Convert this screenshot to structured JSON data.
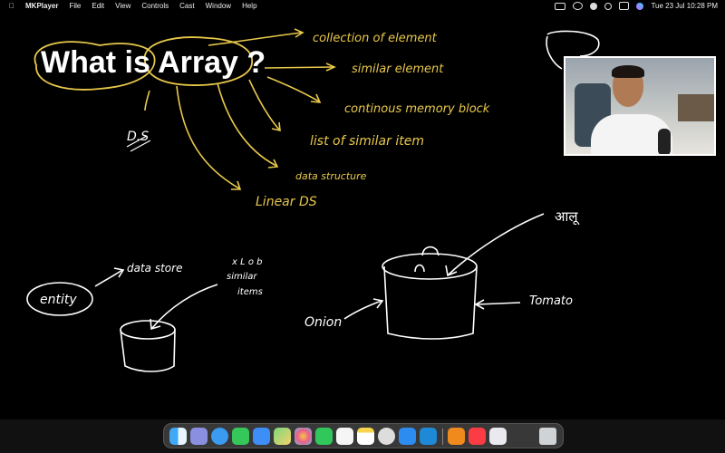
{
  "menubar": {
    "apple_glyph": "",
    "app_name": "MKPlayer",
    "menus": [
      "File",
      "Edit",
      "View",
      "Controls",
      "Cast",
      "Window",
      "Help"
    ],
    "clock": "Tue 23 Jul  10:28 PM"
  },
  "whiteboard": {
    "title": "What is Array ?",
    "ds_abbrev": "D.S",
    "definitions": [
      "collection of element",
      "similar element",
      "continous memory block",
      "list of similar item",
      "data structure",
      "Linear DS"
    ],
    "entity_label": "entity",
    "data_store_label": "data store",
    "items_note": [
      "x L o b",
      "similar",
      "items"
    ],
    "onion_label": "Onion",
    "tomato_label": "Tomato",
    "aloo_label": "आलू"
  },
  "dock": {
    "apps": [
      "finder",
      "launchpad",
      "safari",
      "messages",
      "mail",
      "maps",
      "photos",
      "facetime",
      "reminders",
      "notes",
      "chrome",
      "app-store",
      "vscode",
      "vlc",
      "music",
      "preview",
      "trash"
    ]
  },
  "colors": {
    "ink_yellow": "#e8c84a",
    "ink_white": "#ffffff",
    "board": "#000000"
  }
}
